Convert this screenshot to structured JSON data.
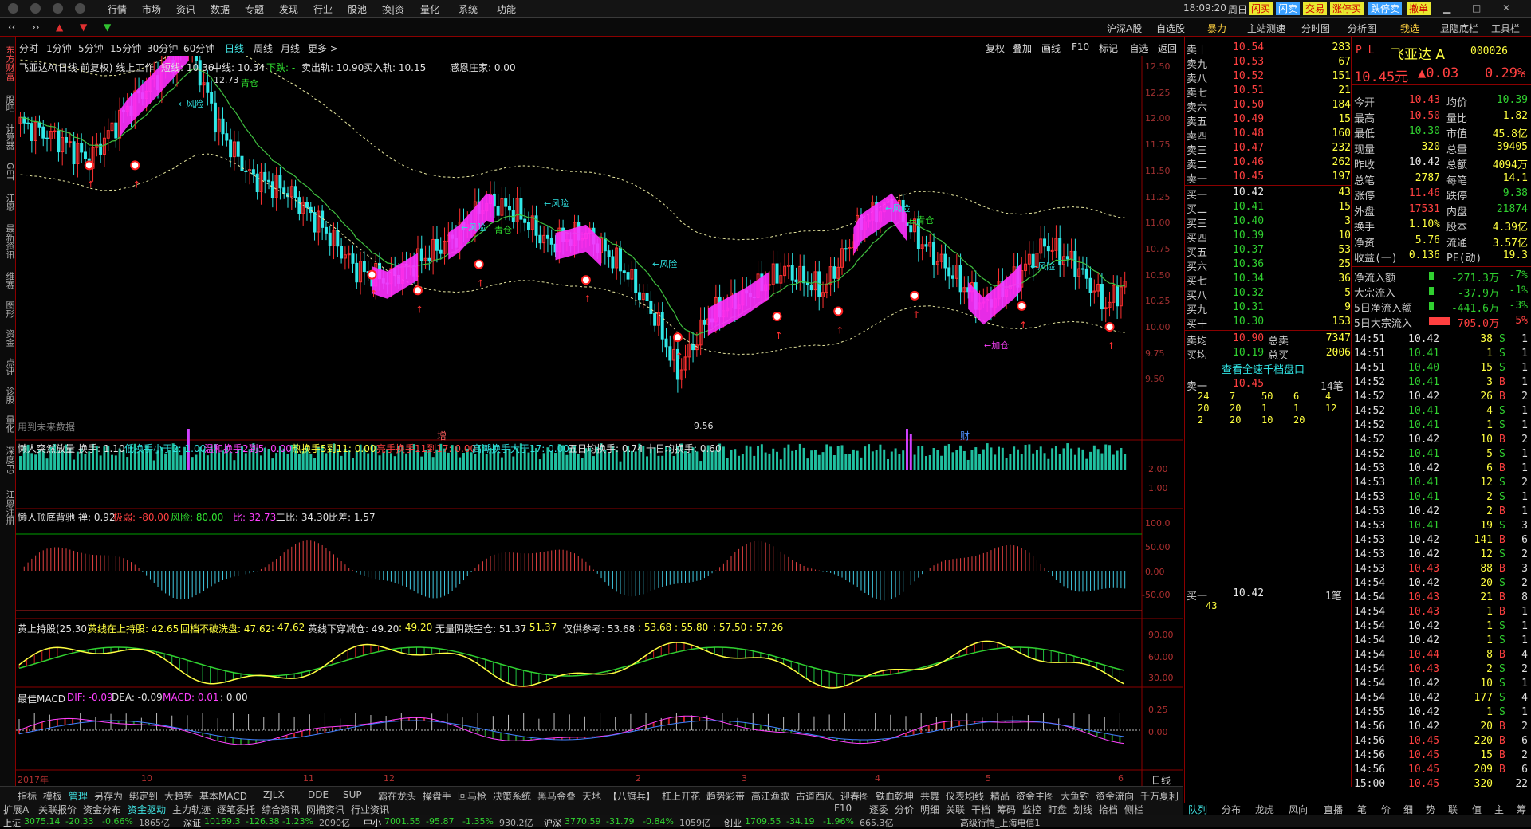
{
  "menu": {
    "items": [
      "行情",
      "市场",
      "资讯",
      "数据",
      "专题",
      "发现",
      "行业",
      "股池",
      "换|资",
      "量化",
      "系统",
      "功能"
    ],
    "time": "18:09:20",
    "weekday": "周日",
    "badges": [
      "闪买",
      "闪卖",
      "交易",
      "涨停买",
      "跌停卖",
      "撤单"
    ]
  },
  "toolbar": {
    "items": [
      "沪深A股",
      "自选股",
      "暴力",
      "主站测速",
      "分时图",
      "分析图",
      "我选",
      "显隐底栏",
      "工具栏"
    ]
  },
  "leftnav": [
    "东方财富",
    "股吧",
    "计算器",
    "GET",
    "江恩",
    "最新资讯",
    "维赛",
    "图形",
    "资金",
    "点评",
    "诊股",
    "量化",
    "深度F9",
    "江恩注册"
  ],
  "periods": [
    "分时",
    "1分钟",
    "5分钟",
    "15分钟",
    "30分钟",
    "60分钟",
    "日线",
    "周线",
    "月线",
    "更多 >"
  ],
  "chart_tools": [
    "复权",
    "叠加",
    "画线",
    "F10",
    "标记",
    "-自选",
    "返回"
  ],
  "main": {
    "title": "飞亚达A(日线 前复权) 线上工作",
    "ma": "短线: 10.36",
    "mid": "中线: 10.34",
    "down": "下跌: -",
    "sell": "卖出轨: 10.90",
    "buy": "买入轨: 10.15",
    "emo": "感恩庄家: 0.00",
    "high": "12.73",
    "low": "9.56",
    "future": "用到未来数据",
    "marks": [
      "增",
      "财"
    ],
    "labels": [
      "青仓",
      "风险",
      "风险",
      "风险",
      "青仓",
      "风险",
      "风险",
      "青仓",
      "风险",
      "加仓"
    ],
    "yticks": [
      "12.50",
      "12.25",
      "12.00",
      "11.75",
      "11.50",
      "11.25",
      "11.00",
      "10.75",
      "10.50",
      "10.25",
      "10.00",
      "9.75",
      "9.50"
    ]
  },
  "vol": {
    "title": "懒人突然放量",
    "hs": "换手: 1.10",
    "low": "低换手小于2: 1.00",
    "mild": "温和换手2到5: 0.00",
    "hot": "热换手5到11: 0.00",
    "big": "亮手换手11到17: 0.00",
    "hi": "高潮换手大于17: 0.00",
    "avg5": "五日均换手: 0.74",
    "avg10": "十日均换手: 0.60",
    "yticks": [
      "2.00",
      "1.00"
    ]
  },
  "osc": {
    "title": "懒人顶底背驰",
    "v1": "禅: 0.92",
    "v2": "极弱: -80.00",
    "v3": "风险: 80.00",
    "v4": "一比: 32.73",
    "v5": "二比: 34.30",
    "v6": "比差: 1.57",
    "yticks": [
      "100.0",
      "50.00",
      "0.00",
      "-50.00"
    ]
  },
  "hs": {
    "title": "黄上持股(25,30)",
    "a": "黄线在上持股: 42.65",
    "b": "回档不破洗盘: 47.62",
    "c": ": 47.62",
    "d": "黄线下穿减仓: 49.20",
    "e": ": 49.20",
    "f": "无量阴跌空仓: 51.37",
    "g": ": 51.37",
    "h": "仅供参考: 53.68",
    "i": ": 53.68",
    "j": ": 55.80",
    "k": ": 57.50",
    "l": ": 57.26",
    "yticks": [
      "90.00",
      "60.00",
      "30.00"
    ]
  },
  "macd": {
    "title": "最佳MACD",
    "dif": "DIF: -0.09",
    "dea": "DEA: -0.09",
    "macd": "MACD: 0.01",
    "z": ": 0.00",
    "yticks": [
      "0.25",
      "0.00"
    ]
  },
  "months": [
    "2017年",
    "10",
    "11",
    "12",
    "2",
    "3",
    "4",
    "5",
    "6"
  ],
  "axis_tools": [
    "日线",
    "+",
    "-",
    "0"
  ],
  "stock": {
    "pl": "P L",
    "name": "飞亚达 A",
    "code": "000026",
    "price": "10.45元",
    "chg": "▲0.03",
    "pct": "0.29%"
  },
  "asks": [
    [
      "卖十",
      "10.54",
      "283"
    ],
    [
      "卖九",
      "10.53",
      "67"
    ],
    [
      "卖八",
      "10.52",
      "151"
    ],
    [
      "卖七",
      "10.51",
      "21"
    ],
    [
      "卖六",
      "10.50",
      "184"
    ],
    [
      "卖五",
      "10.49",
      "15"
    ],
    [
      "卖四",
      "10.48",
      "160"
    ],
    [
      "卖三",
      "10.47",
      "232"
    ],
    [
      "卖二",
      "10.46",
      "262"
    ],
    [
      "卖一",
      "10.45",
      "197"
    ]
  ],
  "bids": [
    [
      "买一",
      "10.42",
      "43"
    ],
    [
      "买二",
      "10.41",
      "15"
    ],
    [
      "买三",
      "10.40",
      "3"
    ],
    [
      "买四",
      "10.39",
      "10"
    ],
    [
      "买五",
      "10.37",
      "53"
    ],
    [
      "买六",
      "10.36",
      "25"
    ],
    [
      "买七",
      "10.34",
      "36"
    ],
    [
      "买八",
      "10.32",
      "5"
    ],
    [
      "买九",
      "10.31",
      "9"
    ],
    [
      "买十",
      "10.30",
      "153"
    ]
  ],
  "avg": {
    "sell_l": "卖均",
    "sell": "10.90",
    "tsell_l": "总卖",
    "tsell": "7347",
    "buy_l": "买均",
    "buy": "10.19",
    "tbuy_l": "总买",
    "tbuy": "2006"
  },
  "depth_link": "查看全速千档盘口",
  "queue1": {
    "label": "卖一",
    "price": "10.45",
    "count": "14笔",
    "nums": [
      "24",
      "7",
      "50",
      "6",
      "4",
      "20",
      "20",
      "1",
      "1",
      "12",
      "2",
      "20",
      "10",
      "20"
    ]
  },
  "queue2": {
    "label": "买一",
    "price": "10.42",
    "count": "1笔",
    "nums": [
      "43"
    ]
  },
  "stats": [
    [
      "今开",
      "10.43",
      "均价",
      "10.39"
    ],
    [
      "最高",
      "10.50",
      "量比",
      "1.82"
    ],
    [
      "最低",
      "10.30",
      "市值",
      "45.8亿"
    ],
    [
      "现量",
      "320",
      "总量",
      "39405"
    ],
    [
      "昨收",
      "10.42",
      "总额",
      "4094万"
    ],
    [
      "总笔",
      "2787",
      "每笔",
      "14.1"
    ],
    [
      "涨停",
      "11.46",
      "跌停",
      "9.38"
    ],
    [
      "外盘",
      "17531",
      "内盘",
      "21874"
    ],
    [
      "换手",
      "1.10%",
      "股本",
      "4.39亿"
    ],
    [
      "净资",
      "5.76",
      "流通",
      "3.57亿"
    ],
    [
      "收益(一)",
      "0.136",
      "PE(动)",
      "19.3"
    ]
  ],
  "flows": [
    [
      "净流入额",
      "-271.3万",
      "-7%"
    ],
    [
      "大宗流入",
      "-37.9万",
      "-1%"
    ],
    [
      "5日净流入额",
      "-441.6万",
      "-3%"
    ],
    [
      "5日大宗流入",
      "705.0万",
      "5%"
    ]
  ],
  "ticks": [
    [
      "14:51",
      "10.42",
      "38",
      "S",
      "1"
    ],
    [
      "14:51",
      "10.41",
      "1",
      "S",
      "1"
    ],
    [
      "14:51",
      "10.40",
      "15",
      "S",
      "1"
    ],
    [
      "14:52",
      "10.41",
      "3",
      "B",
      "1"
    ],
    [
      "14:52",
      "10.42",
      "26",
      "B",
      "2"
    ],
    [
      "14:52",
      "10.41",
      "4",
      "S",
      "1"
    ],
    [
      "14:52",
      "10.41",
      "1",
      "S",
      "1"
    ],
    [
      "14:52",
      "10.42",
      "10",
      "B",
      "2"
    ],
    [
      "14:52",
      "10.41",
      "5",
      "S",
      "1"
    ],
    [
      "14:53",
      "10.42",
      "6",
      "B",
      "1"
    ],
    [
      "14:53",
      "10.41",
      "12",
      "S",
      "2"
    ],
    [
      "14:53",
      "10.41",
      "2",
      "S",
      "1"
    ],
    [
      "14:53",
      "10.42",
      "2",
      "B",
      "1"
    ],
    [
      "14:53",
      "10.41",
      "19",
      "S",
      "3"
    ],
    [
      "14:53",
      "10.42",
      "141",
      "B",
      "6"
    ],
    [
      "14:53",
      "10.42",
      "12",
      "S",
      "2"
    ],
    [
      "14:53",
      "10.43",
      "88",
      "B",
      "3"
    ],
    [
      "14:54",
      "10.42",
      "20",
      "S",
      "2"
    ],
    [
      "14:54",
      "10.43",
      "21",
      "B",
      "8"
    ],
    [
      "14:54",
      "10.43",
      "1",
      "B",
      "1"
    ],
    [
      "14:54",
      "10.42",
      "1",
      "S",
      "1"
    ],
    [
      "14:54",
      "10.42",
      "1",
      "S",
      "1"
    ],
    [
      "14:54",
      "10.44",
      "8",
      "B",
      "4"
    ],
    [
      "14:54",
      "10.43",
      "2",
      "S",
      "2"
    ],
    [
      "14:54",
      "10.42",
      "10",
      "S",
      "1"
    ],
    [
      "14:54",
      "10.42",
      "177",
      "S",
      "4"
    ],
    [
      "14:55",
      "10.42",
      "1",
      "S",
      "1"
    ],
    [
      "14:56",
      "10.42",
      "20",
      "B",
      "2"
    ],
    [
      "14:56",
      "10.45",
      "220",
      "B",
      "6"
    ],
    [
      "14:56",
      "10.45",
      "15",
      "B",
      "2"
    ],
    [
      "14:56",
      "10.45",
      "209",
      "B",
      "6"
    ],
    [
      "15:00",
      "10.45",
      "320",
      "",
      "22"
    ]
  ],
  "right_tabs": [
    "队列",
    "分布",
    "龙虎",
    "风向",
    "直播",
    "笔",
    "价",
    "细",
    "势",
    "联",
    "值",
    "主",
    "筹"
  ],
  "bottom1": [
    "指标",
    "模板",
    "管理",
    "另存为",
    "绑定到",
    "大趋势",
    "基本MACD",
    "ZJLX",
    "DDE",
    "SUP",
    "霸在龙头",
    "操盘手",
    "回马枪",
    "决策系统",
    "黑马金叠",
    "天地",
    "【八旗兵】",
    "杠上开花",
    "趋势彩带",
    "高江渔歌",
    "古道西风",
    "迎春图",
    "铁血乾坤",
    "共舞",
    "仪表均线",
    "精品",
    "资金主图",
    "大鱼钓",
    "资金流向",
    "千万夏利"
  ],
  "bottom2": [
    "扩展A",
    "关联报价",
    "资金分布",
    "资金驱动",
    "主力轨迹",
    "逐笔委托",
    "综合资讯",
    "网摘资讯",
    "行业资讯"
  ],
  "bottom2_right": [
    "F10",
    "逐委",
    "分价",
    "明细",
    "关联",
    "干档",
    "筹码",
    "监控",
    "盯盘",
    "划线",
    "拾档",
    "侧栏"
  ],
  "status": [
    [
      "上证",
      "3075.14",
      "-20.33",
      "-0.66%",
      "1865亿"
    ],
    [
      "深证",
      "10169.3",
      "-126.38",
      "-1.23%",
      "2090亿"
    ],
    [
      "中小",
      "7001.55",
      "-95.87",
      "-1.35%",
      "930.2亿"
    ],
    [
      "沪深",
      "3770.59",
      "-31.79",
      "-0.84%",
      "1059亿"
    ],
    [
      "创业",
      "1709.55",
      "-34.19",
      "-1.96%",
      "665.3亿"
    ]
  ],
  "status_right": "高级行情_上海电信1"
}
